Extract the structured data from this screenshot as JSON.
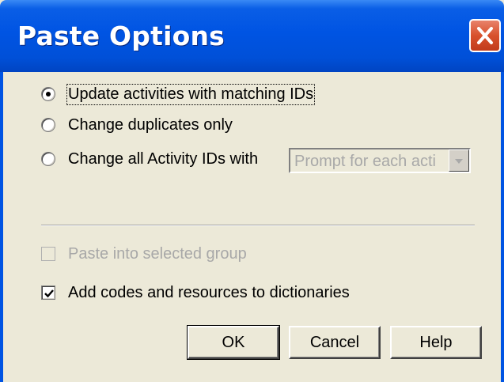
{
  "window": {
    "title": "Paste Options"
  },
  "options": {
    "update_label": "Update activities with matching IDs",
    "change_duplicates_label": "Change duplicates only",
    "change_all_label": "Change all Activity IDs with",
    "selected": "update"
  },
  "combo": {
    "value": "Prompt for each acti"
  },
  "checks": {
    "paste_into_group_label": "Paste into selected group",
    "paste_into_group_checked": false,
    "paste_into_group_enabled": false,
    "add_codes_label": "Add codes and resources to dictionaries",
    "add_codes_checked": true
  },
  "buttons": {
    "ok": "OK",
    "cancel": "Cancel",
    "help": "Help"
  },
  "icons": {
    "close": "close-icon",
    "radio_selected": "radio-selected-icon",
    "checkmark": "checkmark-icon",
    "dropdown": "chevron-down-icon"
  },
  "colors": {
    "titlebar": "#0054e3",
    "close_button": "#d8512c",
    "dialog_background": "#ece9d8",
    "disabled_text": "#a8a8a8"
  }
}
